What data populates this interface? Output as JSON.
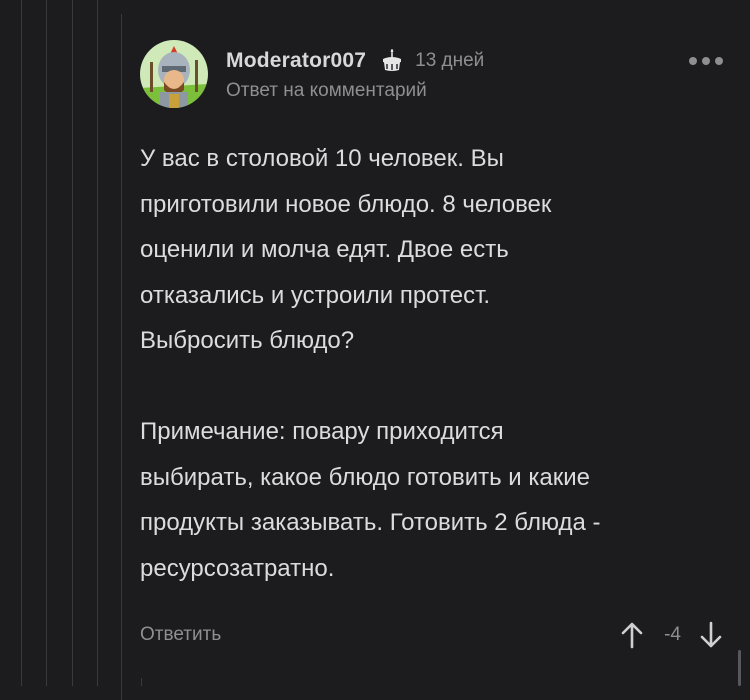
{
  "comment": {
    "username": "Moderator007",
    "time_ago": "13 дней",
    "reply_context": "Ответ на комментарий",
    "paragraph1": "У вас в столовой 10 человек. Вы\nприготовили новое блюдо. 8 человек\nоценили и молча едят. Двое есть\nотказались и устроили протест.\nВыбросить блюдо?",
    "paragraph2": "Примечание: повару приходится\nвыбирать, какое блюдо готовить и какие\nпродукты заказывать. Готовить 2 блюда -\nресурсозатратно.",
    "reply_label": "Ответить",
    "rating": "-4"
  },
  "icons": {
    "badge": "cake-icon",
    "more": "more-dots-icon",
    "upvote": "arrow-up-icon",
    "downvote": "arrow-down-icon"
  },
  "colors": {
    "background": "#1c1c1e",
    "text": "#dcdcdc",
    "muted": "#8e8e93",
    "thread_line": "#3a3a3d"
  }
}
